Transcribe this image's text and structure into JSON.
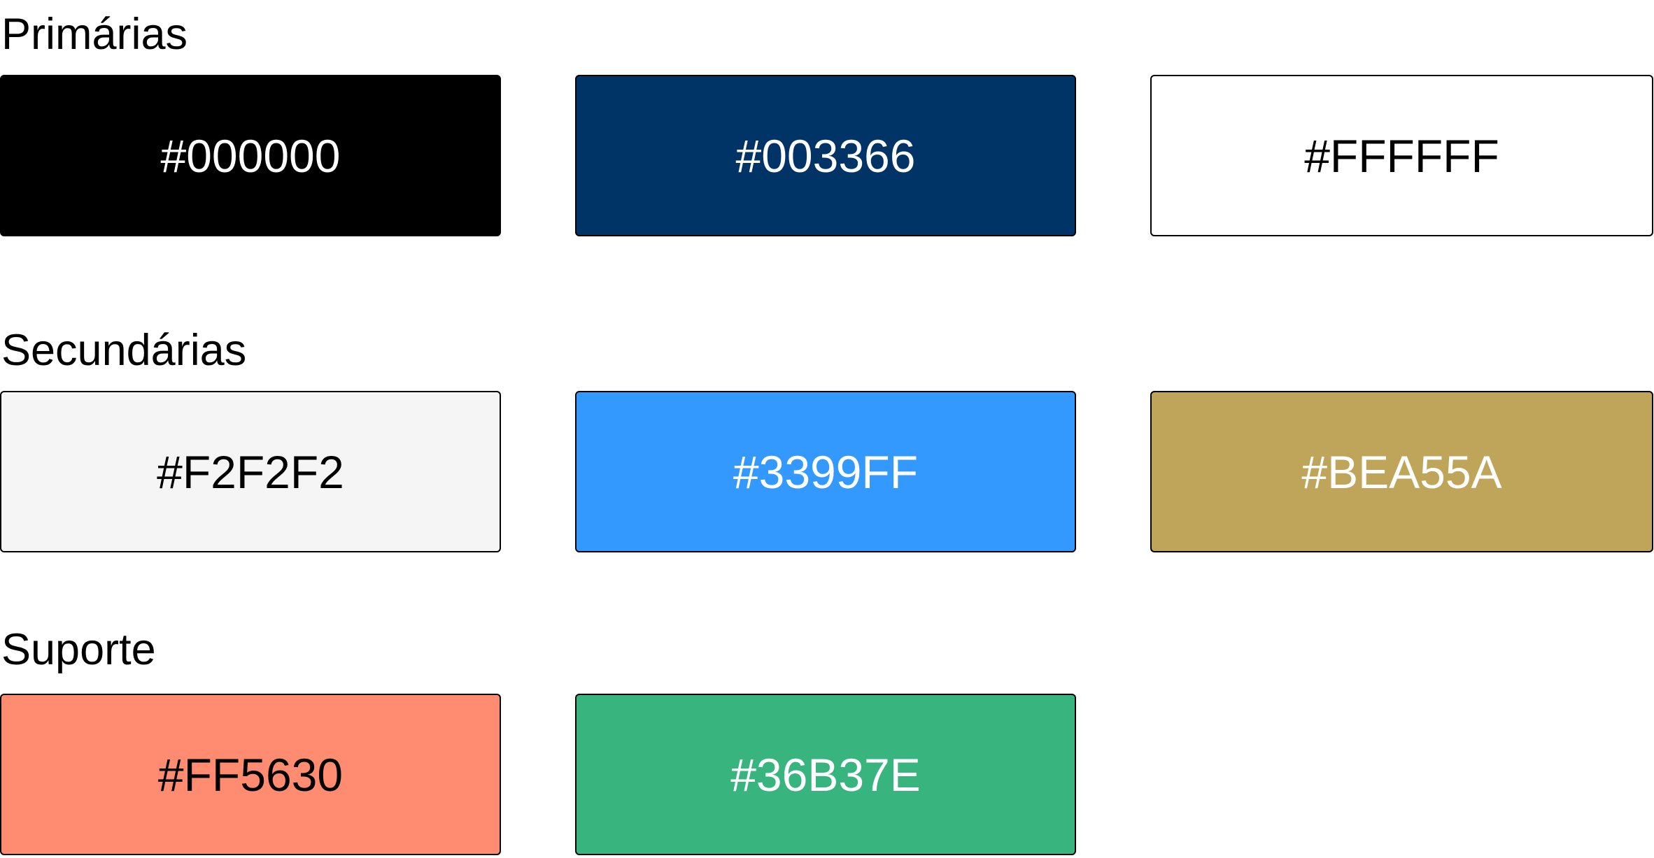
{
  "sections": [
    {
      "title": "Primárias",
      "swatches": [
        {
          "label": "#000000",
          "color": "#000000",
          "text_color": "#FFFFFF"
        },
        {
          "label": "#003366",
          "color": "#003366",
          "text_color": "#FFFFFF"
        },
        {
          "label": "#FFFFFF",
          "color": "#FFFFFF",
          "text_color": "#000000"
        }
      ]
    },
    {
      "title": "Secundárias",
      "swatches": [
        {
          "label": "#F2F2F2",
          "color": "#F5F5F5",
          "text_color": "#000000"
        },
        {
          "label": "#3399FF",
          "color": "#3399FF",
          "text_color": "#FFFFFF"
        },
        {
          "label": "#BEA55A",
          "color": "#BFA55A",
          "text_color": "#FFFFFF"
        }
      ]
    },
    {
      "title": "Suporte",
      "swatches": [
        {
          "label": "#FF5630",
          "color": "#FF8B70",
          "text_color": "#000000"
        },
        {
          "label": "#36B37E",
          "color": "#38B47F",
          "text_color": "#FFFFFF"
        }
      ]
    }
  ]
}
